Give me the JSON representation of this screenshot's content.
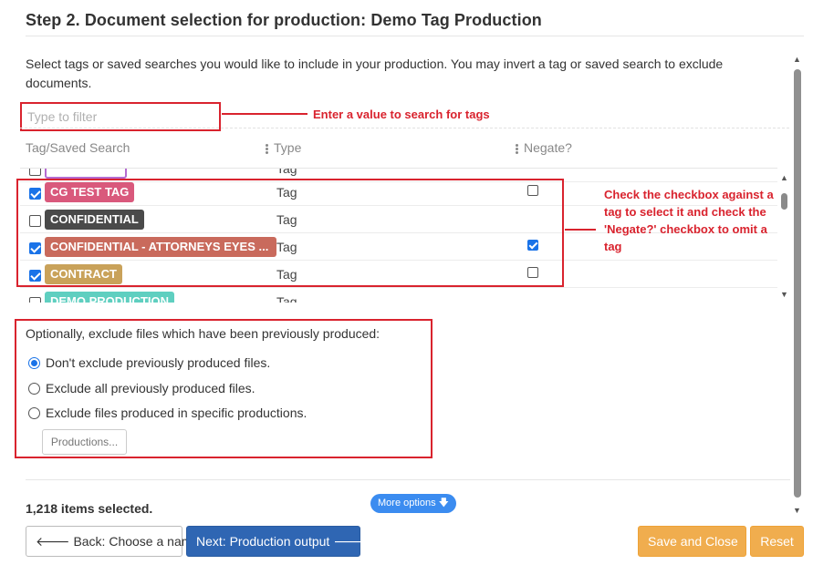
{
  "header": {
    "title": "Step 2. Document selection for production: Demo Tag Production"
  },
  "intro": "Select tags or saved searches you would like to include in your production. You may invert a tag or saved search to exclude documents.",
  "filter": {
    "placeholder": "Type to filter",
    "annotation": "Enter a value to search for tags"
  },
  "grid": {
    "columns": [
      "Tag/Saved Search",
      "Type",
      "Negate?"
    ],
    "rows": [
      {
        "name": "",
        "type": "Tag",
        "color": "#ffffff",
        "checked": false,
        "negate": false,
        "partial": "top"
      },
      {
        "name": "CG TEST TAG",
        "type": "Tag",
        "color": "#d9597c",
        "checked": true,
        "negate": false
      },
      {
        "name": "CONFIDENTIAL",
        "type": "Tag",
        "color": "#4a4a4a",
        "checked": false,
        "negate": null
      },
      {
        "name": "CONFIDENTIAL - ATTORNEYS EYES ...",
        "type": "Tag",
        "color": "#c96a5c",
        "checked": true,
        "negate": true
      },
      {
        "name": "CONTRACT",
        "type": "Tag",
        "color": "#c9a25a",
        "checked": true,
        "negate": false
      },
      {
        "name": "DEMO PRODUCTION",
        "type": "Tag",
        "color": "#5fcfc0",
        "checked": false,
        "negate": null,
        "partial": "bottom"
      }
    ],
    "annotation": "Check the checkbox against a tag to select it and check the 'Negate?' checkbox to omit a tag"
  },
  "exclude": {
    "title": "Optionally, exclude files which have been previously produced:",
    "options": [
      {
        "label": "Don't exclude previously produced files.",
        "selected": true
      },
      {
        "label": "Exclude all previously produced files.",
        "selected": false
      },
      {
        "label": "Exclude files produced in specific productions.",
        "selected": false
      }
    ],
    "productions_button": "Productions..."
  },
  "footer": {
    "items_selected": "1,218 items selected.",
    "more_options": "More options",
    "back_label": "Back: Choose a name",
    "next_label": "Next: Production output",
    "save_label": "Save and Close",
    "reset_label": "Reset"
  },
  "colors": {
    "annotation_red": "#d9232e",
    "primary_blue": "#2f66b3",
    "warning_orange": "#f0ad4e",
    "pill_blue": "#3b8cf0"
  }
}
